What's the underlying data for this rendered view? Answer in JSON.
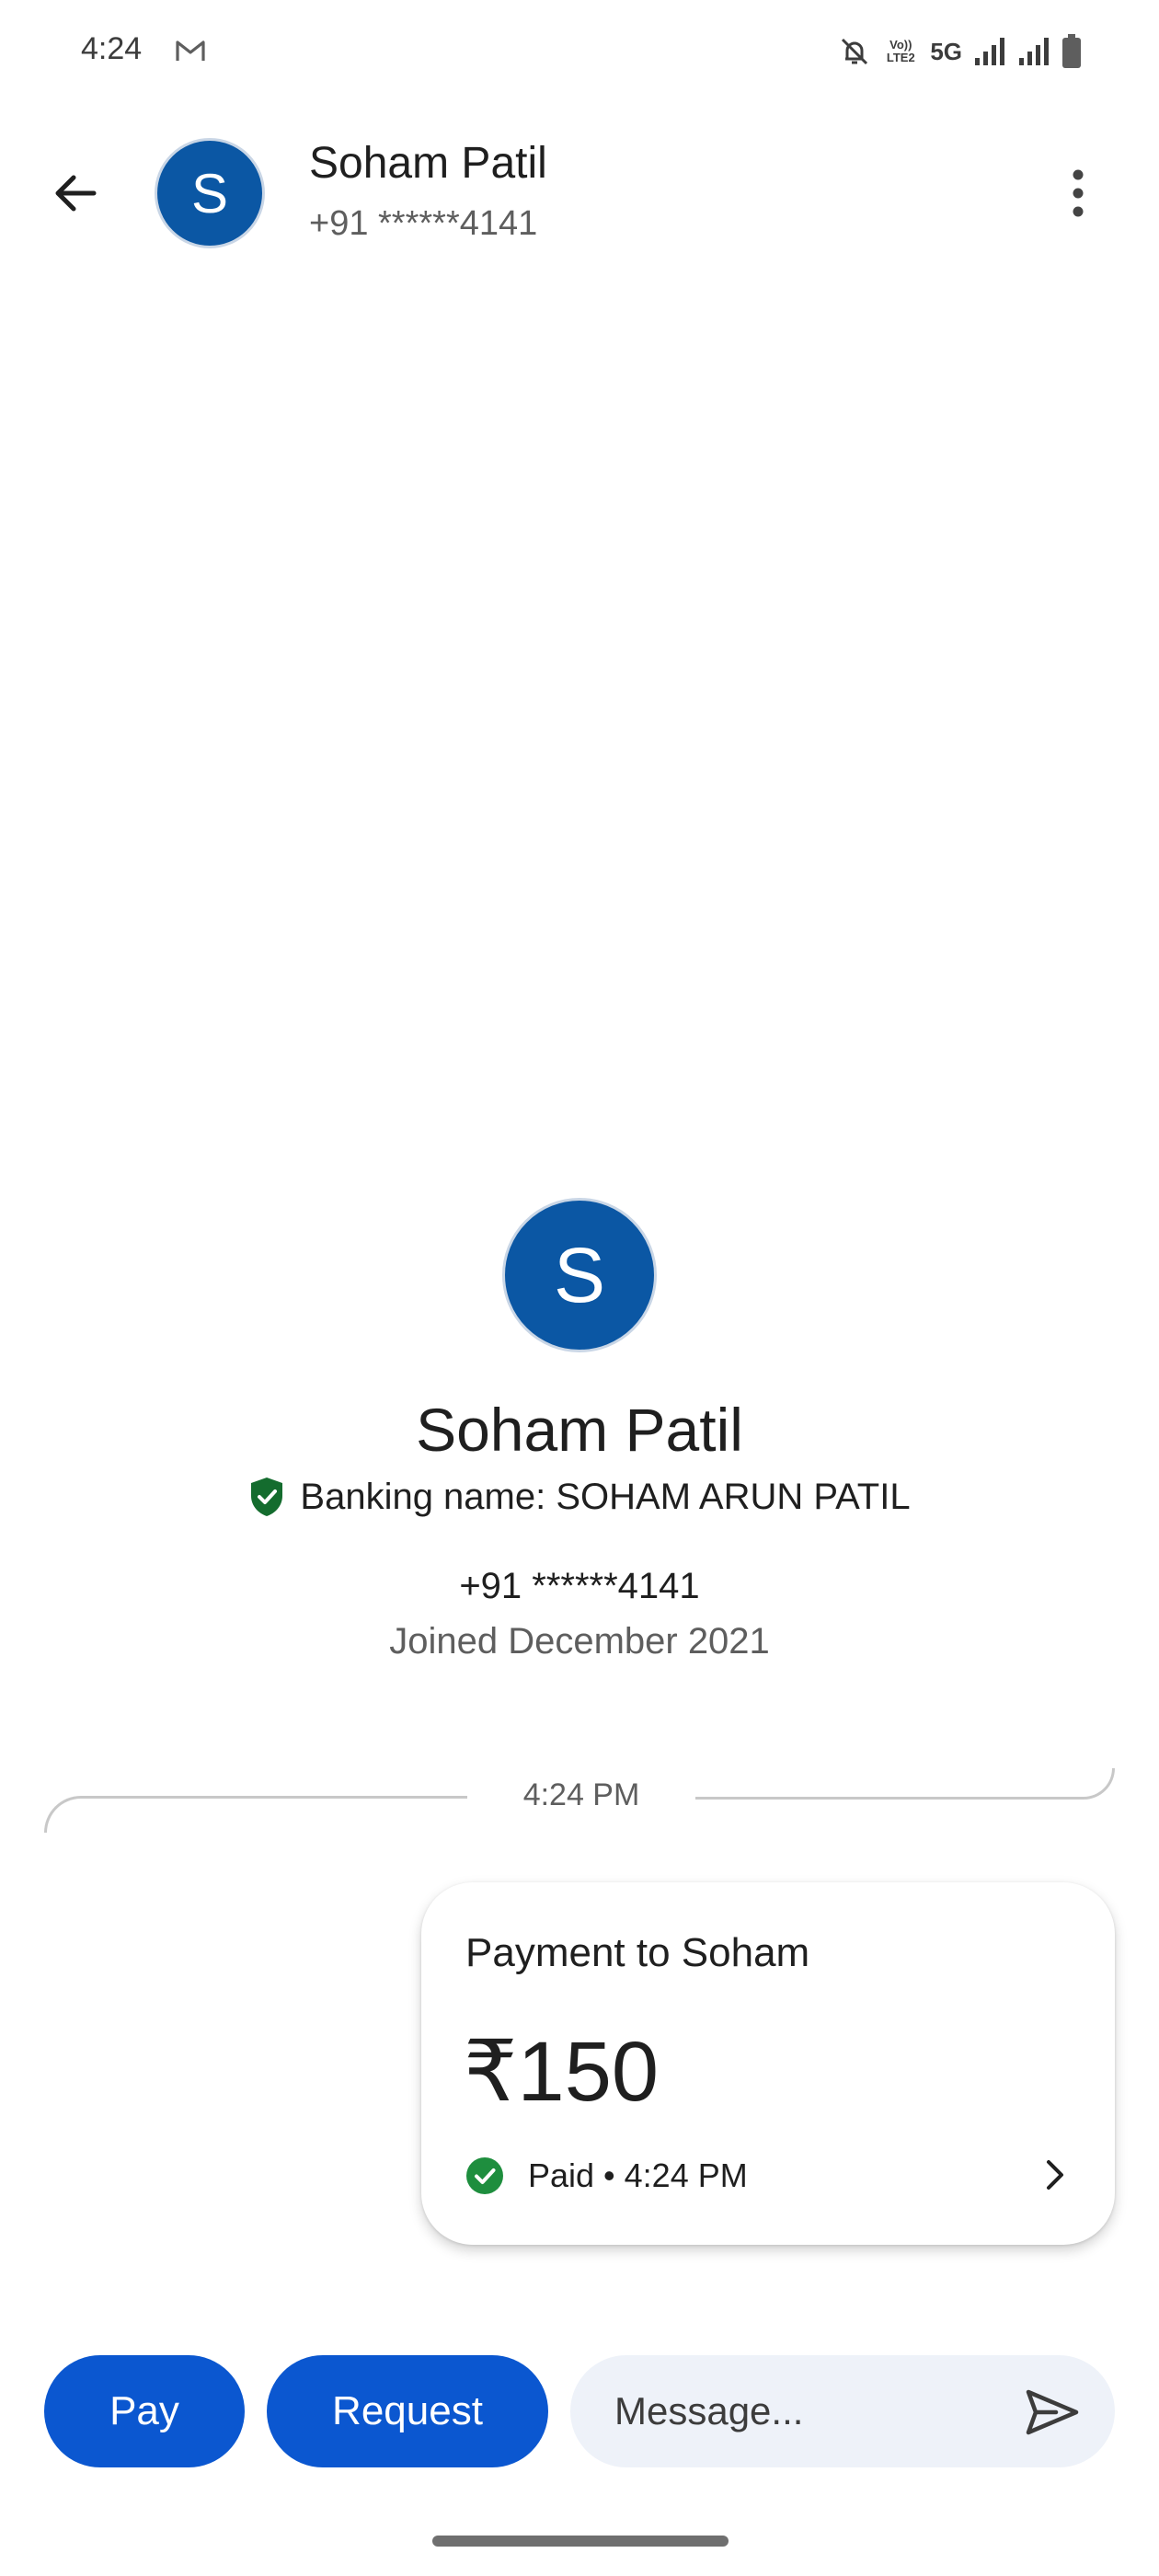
{
  "status_bar": {
    "time": "4:24",
    "volte_label": "Vo)) LTE2",
    "network": "5G",
    "icons": [
      "gmail-icon",
      "bell-off-icon",
      "signal-icon",
      "signal-icon",
      "battery-icon"
    ]
  },
  "header": {
    "avatar_letter": "S",
    "name": "Soham Patil",
    "phone": "+91 ******4141",
    "icons": [
      "arrow-left-icon",
      "more-vertical-icon"
    ]
  },
  "profile": {
    "avatar_letter": "S",
    "name": "Soham Patil",
    "banking_name": "Banking name: SOHAM ARUN PATIL",
    "phone": "+91 ******4141",
    "joined": "Joined December 2021",
    "icons": [
      "verified-shield-icon"
    ]
  },
  "conversation": {
    "timestamp": "4:24 PM",
    "payment_card": {
      "title": "Payment to Soham",
      "amount": "₹150",
      "status": "Paid • 4:24 PM",
      "status_color": "#1e8e3e",
      "icons": [
        "check-circle-icon",
        "chevron-right-icon"
      ]
    }
  },
  "bottom_bar": {
    "pay_label": "Pay",
    "request_label": "Request",
    "message_placeholder": "Message...",
    "accent_color": "#0b57d0",
    "icons": [
      "send-icon"
    ]
  }
}
